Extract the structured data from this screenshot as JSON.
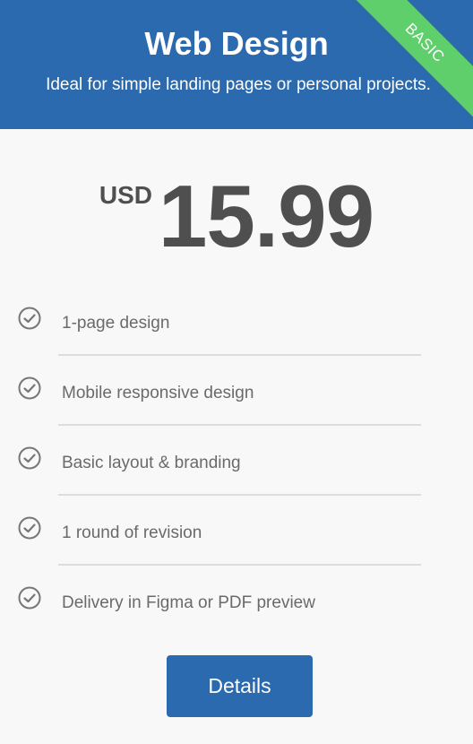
{
  "header": {
    "title": "Web Design",
    "subtitle": "Ideal for simple landing pages or personal projects.",
    "badge": "BASIC"
  },
  "price": {
    "currency": "USD",
    "amount": "15.99"
  },
  "features": [
    {
      "label": "1-page design",
      "icon": "check-circle-icon"
    },
    {
      "label": "Mobile responsive design",
      "icon": "check-circle-icon"
    },
    {
      "label": "Basic layout & branding",
      "icon": "check-circle-icon"
    },
    {
      "label": "1 round of revision",
      "icon": "check-circle-icon"
    },
    {
      "label": "Delivery in Figma or PDF preview",
      "icon": "check-circle-icon"
    }
  ],
  "actions": {
    "details_label": "Details"
  },
  "colors": {
    "primary": "#2b6aaf",
    "badge": "#5ecf6b",
    "background": "#f7f8f7",
    "text": "#6a6a6a",
    "price_text": "#4f4f4f"
  }
}
